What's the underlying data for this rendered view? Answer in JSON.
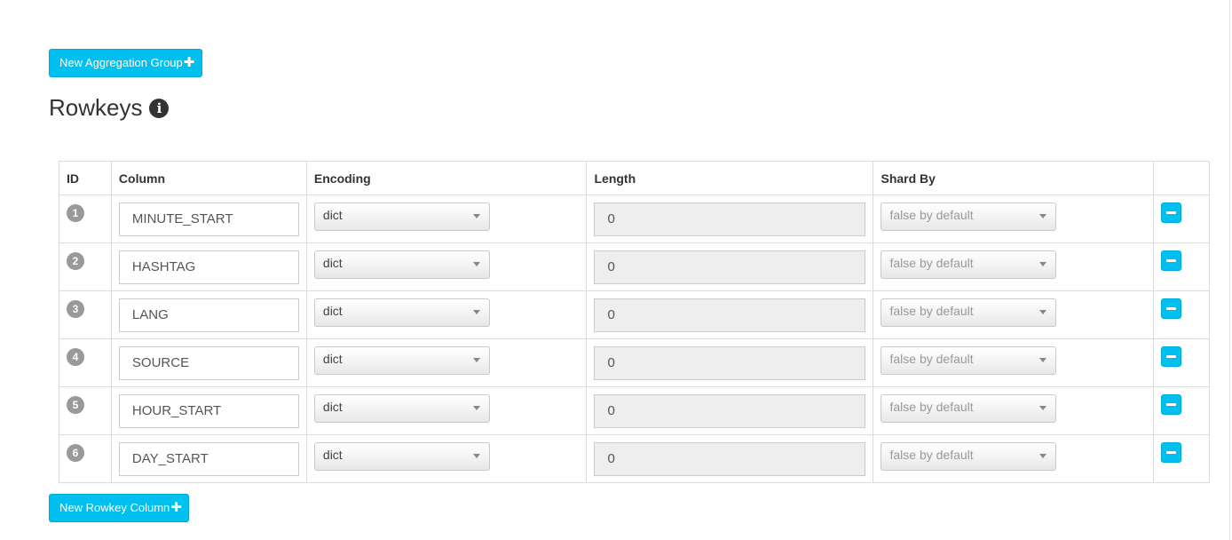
{
  "toolbar": {
    "new_aggregation_group_label": "New Aggregation Group",
    "new_rowkey_column_label": "New Rowkey Column",
    "plus_glyph": "✚"
  },
  "section": {
    "title": "Rowkeys",
    "info_glyph": "i"
  },
  "table": {
    "headers": {
      "id": "ID",
      "column": "Column",
      "encoding": "Encoding",
      "length": "Length",
      "shard_by": "Shard By",
      "action": ""
    },
    "rows": [
      {
        "id": "1",
        "column": "MINUTE_START",
        "encoding": "dict",
        "length": "0",
        "shard_by": "false by default"
      },
      {
        "id": "2",
        "column": "HASHTAG",
        "encoding": "dict",
        "length": "0",
        "shard_by": "false by default"
      },
      {
        "id": "3",
        "column": "LANG",
        "encoding": "dict",
        "length": "0",
        "shard_by": "false by default"
      },
      {
        "id": "4",
        "column": "SOURCE",
        "encoding": "dict",
        "length": "0",
        "shard_by": "false by default"
      },
      {
        "id": "5",
        "column": "HOUR_START",
        "encoding": "dict",
        "length": "0",
        "shard_by": "false by default"
      },
      {
        "id": "6",
        "column": "DAY_START",
        "encoding": "dict",
        "length": "0",
        "shard_by": "false by default"
      }
    ]
  },
  "colors": {
    "accent": "#00c0ef",
    "badge": "#999999",
    "disabled_input": "#eeeeee"
  },
  "icons": {
    "info": "info-circle-icon",
    "plus": "plus-icon",
    "remove": "minus-icon",
    "dropdown": "caret-down-icon"
  }
}
